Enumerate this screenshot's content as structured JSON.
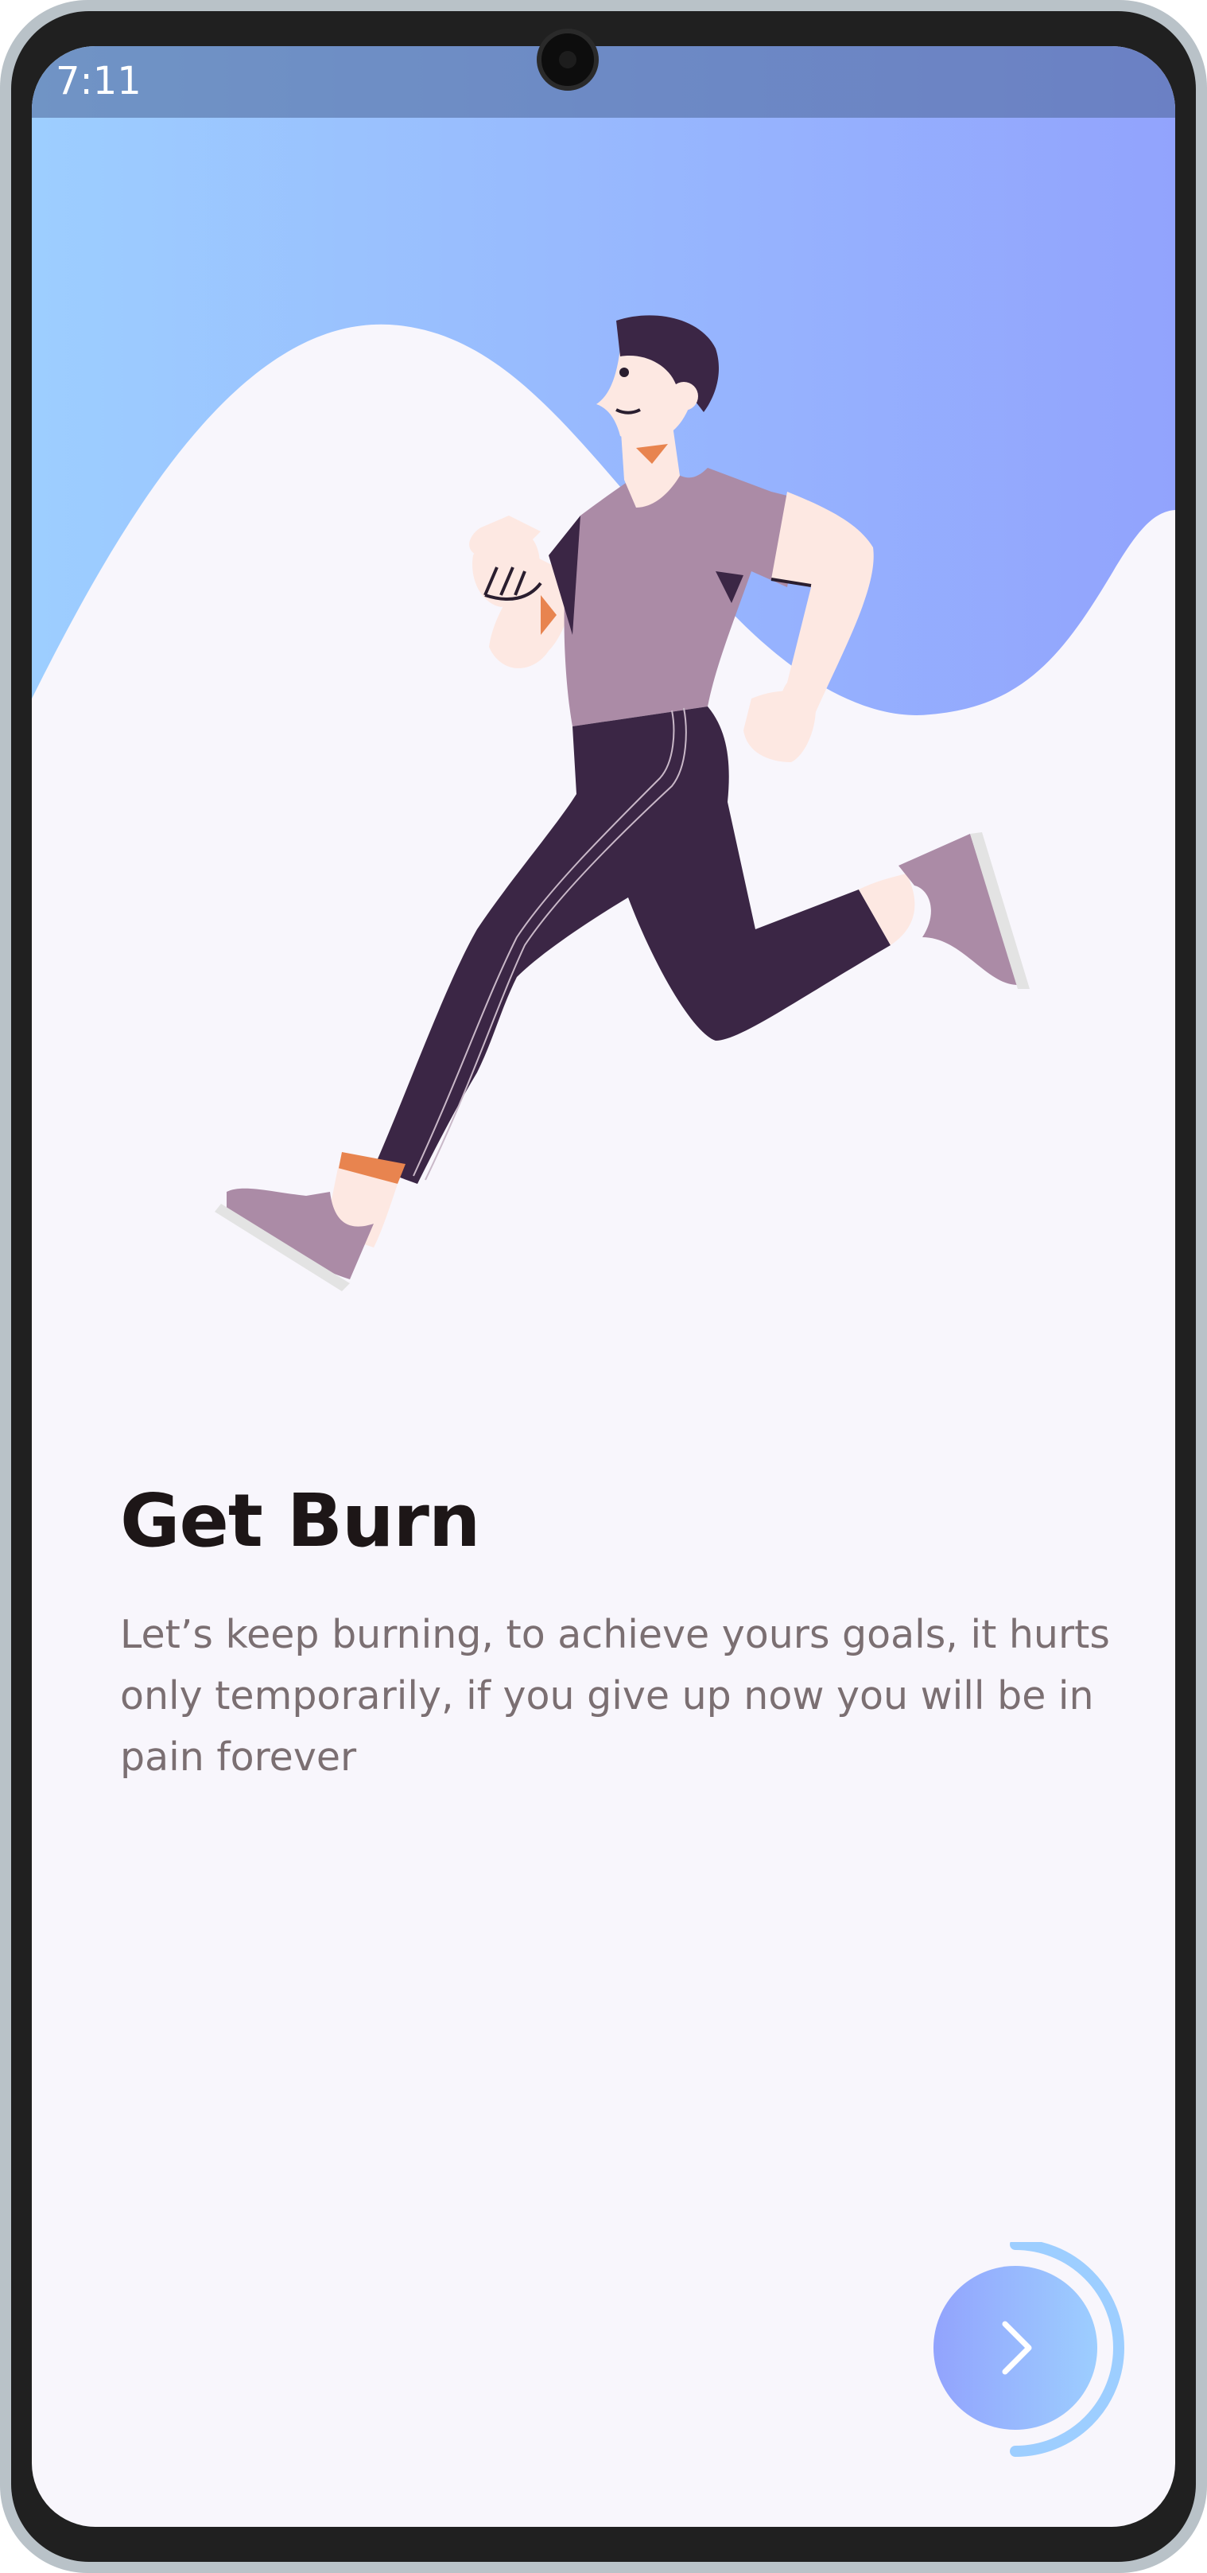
{
  "status_bar": {
    "time": "7:11"
  },
  "onboarding": {
    "title": "Get Burn",
    "description": "Let’s keep burning, to achieve yours goals, it hurts only temporarily, if you give up now you will be in pain forever",
    "progress": 0.5,
    "next_icon": "chevron-right-icon",
    "illustration": "running-man-illustration"
  },
  "colors": {
    "gradient_start": "#9dceff",
    "gradient_end": "#92a3fd",
    "background": "#f8f6fc",
    "title": "#1d1617",
    "body_text": "#7b6f72",
    "shirt": "#ab8ba6",
    "pants": "#3b2645"
  }
}
